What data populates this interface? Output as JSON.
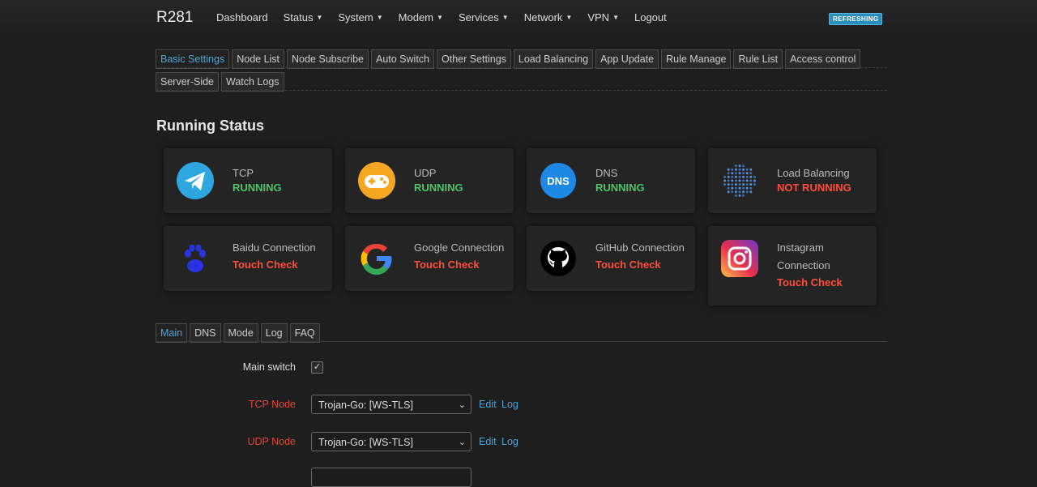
{
  "brand": "R281",
  "nav": {
    "items": [
      {
        "label": "Dashboard",
        "caret": false
      },
      {
        "label": "Status",
        "caret": true
      },
      {
        "label": "System",
        "caret": true
      },
      {
        "label": "Modem",
        "caret": true
      },
      {
        "label": "Services",
        "caret": true
      },
      {
        "label": "Network",
        "caret": true
      },
      {
        "label": "VPN",
        "caret": true
      },
      {
        "label": "Logout",
        "caret": false
      }
    ],
    "badge": "REFRESHING"
  },
  "top_tabs": {
    "row1": [
      "Basic Settings",
      "Node List",
      "Node Subscribe",
      "Auto Switch",
      "Other Settings",
      "Load Balancing",
      "App Update",
      "Rule Manage",
      "Rule List",
      "Access control"
    ],
    "row2": [
      "Server-Side",
      "Watch Logs"
    ],
    "active": "Basic Settings"
  },
  "running_status": {
    "title": "Running Status",
    "cards": [
      {
        "label": "TCP",
        "status": "RUNNING",
        "state": "ok",
        "icon": "telegram-icon"
      },
      {
        "label": "UDP",
        "status": "RUNNING",
        "state": "ok",
        "icon": "gamepad-icon"
      },
      {
        "label": "DNS",
        "status": "RUNNING",
        "state": "ok",
        "icon": "dns-icon",
        "icon_text": "DNS"
      },
      {
        "label": "Load Balancing",
        "status": "NOT RUNNING",
        "state": "bad",
        "icon": "dot-globe-icon"
      },
      {
        "label": "Baidu Connection",
        "status": "Touch Check",
        "state": "bad",
        "icon": "paw-icon"
      },
      {
        "label": "Google Connection",
        "status": "Touch Check",
        "state": "bad",
        "icon": "google-icon"
      },
      {
        "label": "GitHub Connection",
        "status": "Touch Check",
        "state": "bad",
        "icon": "github-icon"
      },
      {
        "label": "Instagram Connection",
        "status": "Touch Check",
        "state": "bad",
        "icon": "instagram-icon"
      }
    ]
  },
  "sub_tabs": {
    "items": [
      "Main",
      "DNS",
      "Mode",
      "Log",
      "FAQ"
    ],
    "active": "Main"
  },
  "form": {
    "main_switch": {
      "label": "Main switch",
      "checked": true
    },
    "tcp_node": {
      "label": "TCP Node",
      "value": "Trojan-Go: [WS-TLS]",
      "edit": "Edit",
      "log": "Log"
    },
    "udp_node": {
      "label": "UDP Node",
      "value": "Trojan-Go: [WS-TLS]",
      "edit": "Edit",
      "log": "Log"
    }
  },
  "colors": {
    "accent": "#4da3d6",
    "running": "#4fc36a",
    "not_running": "#ff4d3a",
    "label_red": "#e0473b"
  }
}
